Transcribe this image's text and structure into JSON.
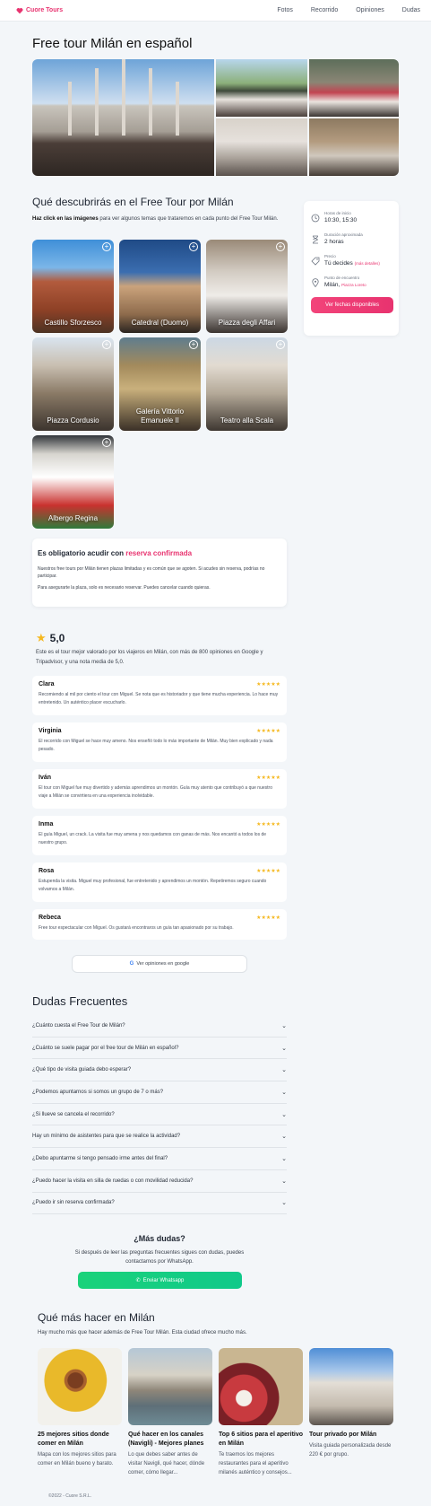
{
  "nav": {
    "brand": "Cuore Tours",
    "links": [
      "Fotos",
      "Recorrido",
      "Opiniones",
      "Dudas"
    ]
  },
  "page_title": "Free tour Milán en español",
  "discover": {
    "title": "Qué descubrirás en el Free Tour por Milán",
    "subtitle_bold": "Haz click en las imágenes",
    "subtitle_rest": " para ver algunos temas que trataremos en cada punto del Free Tour Milán.",
    "places": [
      "Castillo Sforzesco",
      "Catedral (Duomo)",
      "Piazza degli Affari",
      "Piazza Cordusio",
      "Galería Vittorio Emanuele II",
      "Teatro alla Scala",
      "Albergo Regina"
    ]
  },
  "info_card": {
    "horario_label": "Horas de inicio",
    "horario_value": "10:30, 15:30",
    "duracion_label": "Duración aproximada",
    "duracion_value": "2 horas",
    "precio_label": "Precio",
    "precio_value": "Tú decides",
    "precio_link": "(más detalles)",
    "punto_label": "Punto de encuentro",
    "punto_value": "Milán,",
    "punto_link": "Piazza Loreto",
    "cta": "Ver fechas disponibles"
  },
  "notice": {
    "title_plain": "Es obligatorio acudir con ",
    "title_accent": "reserva confirmada",
    "p1": "Nuestros free tours por Milán tienen plazas limitadas y es común que se agoten. Si acudes sin reserva, podrías no participar.",
    "p2": "Para asegurarte la plaza, solo es necesario reservar. Puedes cancelar cuando quieras."
  },
  "rating": {
    "value": "5,0",
    "text": "Este es el tour mejor valorado por los viajeros en Milán, con más de 800 opiniones en Google y Tripadvisor, y una nota media de 5,0."
  },
  "reviews": [
    {
      "name": "Clara",
      "stars": "★★★★★",
      "text": "Recomiendo al mil por ciento el tour con Miguel. Se nota que es historiador y que tiene mucha experiencia. Lo hace muy entretenido. Un auténtico placer escucharlo."
    },
    {
      "name": "Virginia",
      "stars": "★★★★★",
      "text": "El recorrido con Miguel se hace muy ameno. Nos enseñó todo lo más importante de Milán. Muy bien explicado y nada pesado."
    },
    {
      "name": "Iván",
      "stars": "★★★★★",
      "text": "El tour con Miguel fue muy divertido y además aprendimos un montón. Guía muy atento que contribuyó a que nuestro viaje a Milán se convirtiera en una experiencia inolvidable."
    },
    {
      "name": "Inma",
      "stars": "★★★★★",
      "text": "El guía Miguel, un crack. La visita fue muy amena y nos quedamos con ganas de más. Nos encantó a todos los de nuestro grupo."
    },
    {
      "name": "Rosa",
      "stars": "★★★★★",
      "text": "Estupenda la visita. Miguel muy profesional, fue entretenido y aprendimos un montón. Repetiremos seguro cuando volvamos a Milán."
    },
    {
      "name": "Rebeca",
      "stars": "★★★★★",
      "text": "Free tour espectacular con Miguel. Os gustará encontraros un guía tan apasionado por su trabajo."
    }
  ],
  "google_button": "Ver opiniones en google",
  "faq": {
    "title": "Dudas Frecuentes",
    "items": [
      "¿Cuánto cuesta el Free Tour de Milán?",
      "¿Cuánto se suele pagar por el free tour de Milán en español?",
      "¿Qué tipo de visita guiada debo esperar?",
      "¿Podemos apuntarnos si somos un grupo de 7 o más?",
      "¿Si llueve se cancela el recorrido?",
      "Hay un mínimo de asistentes para que se realice la actividad?",
      "¿Debo apuntarme si tengo pensado irme antes del final?",
      "¿Puedo hacer la visita en silla de ruedas o con movilidad reducida?",
      "¿Puedo ir sin reserva confirmada?"
    ]
  },
  "more_questions": {
    "title": "¿Más dudas?",
    "text": "Si después de leer las preguntas frecuentes sigues con dudas, puedes contactarnos por WhatsApp.",
    "button": "Enviar Whatsapp"
  },
  "more_to_do": {
    "title": "Qué más hacer en Milán",
    "subtitle": "Hay mucho más que hacer además de Free Tour Milán. Esta ciudad ofrece mucho más.",
    "cards": [
      {
        "title": "25 mejores sitios donde comer en Milán",
        "text": "Mapa con los mejores sitios para comer en Milán bueno y barato."
      },
      {
        "title": "Qué hacer en los canales (Navigli) - Mejores planes",
        "text": "Lo que debes saber antes de visitar Navigli, qué hacer, dónde comer, cómo llegar..."
      },
      {
        "title": "Top 6 sitios para el aperitivo en Milán",
        "text": "Te traemos los mejores restaurantes para el aperitivo milanés auténtico y consejos..."
      },
      {
        "title": "Tour privado por Milán",
        "text": "Visita guiada personalizada desde 220 € por grupo."
      }
    ]
  },
  "footer": "©2022 - Cuore S.R.L.",
  "colors": {
    "accent": "#e8336f",
    "whatsapp": "#1ad27a",
    "star": "#f5b81f",
    "background": "#f3f6f9"
  }
}
